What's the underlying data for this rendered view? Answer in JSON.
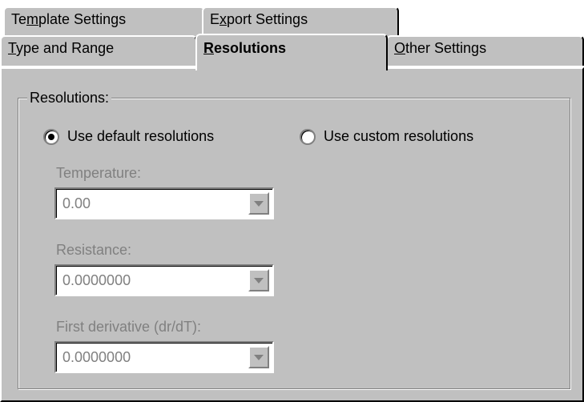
{
  "tabs_back": [
    {
      "pre": "Te",
      "ul": "m",
      "post": "plate Settings"
    },
    {
      "pre": "E",
      "ul": "x",
      "post": "port Settings"
    }
  ],
  "tabs_front": [
    {
      "pre": "",
      "ul": "T",
      "post": "ype and Range"
    },
    {
      "pre": "",
      "ul": "R",
      "post": "esolutions",
      "active": true
    },
    {
      "pre": "",
      "ul": "O",
      "post": "ther Settings"
    }
  ],
  "group": {
    "label": "Resolutions:",
    "radio_default": {
      "label": "Use default resolutions",
      "checked": true
    },
    "radio_custom": {
      "label": "Use custom resolutions",
      "checked": false
    },
    "temperature": {
      "label": "Temperature:",
      "value": "0.00"
    },
    "resistance": {
      "label": "Resistance:",
      "value": "0.0000000"
    },
    "derivative": {
      "label": "First derivative (dr/dT):",
      "value": "0.0000000"
    }
  }
}
